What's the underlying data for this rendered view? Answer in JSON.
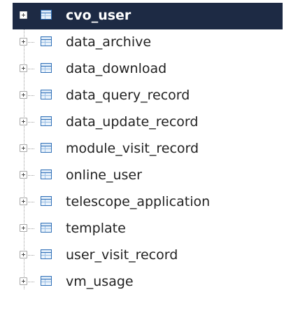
{
  "tree": {
    "items": [
      {
        "label": "cvo_user",
        "selected": true,
        "icon": "table-icon"
      },
      {
        "label": "data_archive",
        "icon": "table-icon"
      },
      {
        "label": "data_download",
        "icon": "table-icon"
      },
      {
        "label": "data_query_record",
        "icon": "table-icon"
      },
      {
        "label": "data_update_record",
        "icon": "table-icon"
      },
      {
        "label": "module_visit_record",
        "icon": "table-icon"
      },
      {
        "label": "online_user",
        "icon": "table-icon"
      },
      {
        "label": "telescope_application",
        "icon": "table-icon"
      },
      {
        "label": "template",
        "icon": "table-icon"
      },
      {
        "label": "user_visit_record",
        "icon": "table-icon"
      },
      {
        "label": "vm_usage",
        "icon": "table-icon"
      }
    ]
  },
  "colors": {
    "selection_bg": "#1d2a44",
    "icon_blue": "#2f6fb7"
  }
}
